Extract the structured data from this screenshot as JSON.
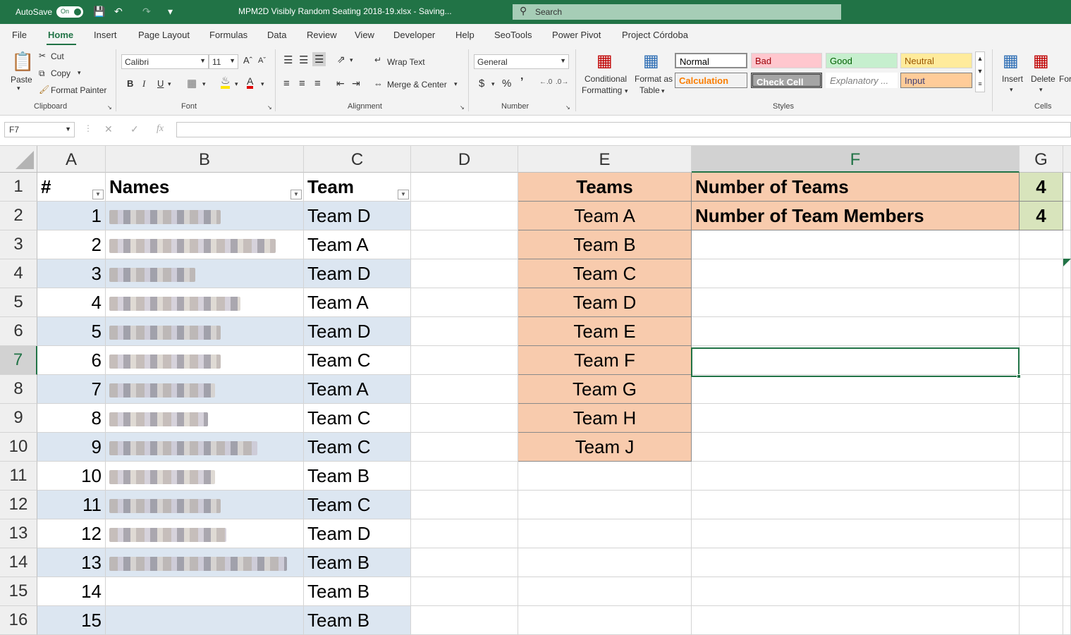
{
  "titlebar": {
    "autosave_label": "AutoSave",
    "toggle_label": "On",
    "document_title": "MPM2D Visibly Random Seating 2018-19.xlsx  -  Saving...",
    "search_placeholder": "Search"
  },
  "ribbon_tabs": [
    "File",
    "Home",
    "Insert",
    "Page Layout",
    "Formulas",
    "Data",
    "Review",
    "View",
    "Developer",
    "Help",
    "SeoTools",
    "Power Pivot",
    "Project Córdoba"
  ],
  "ribbon": {
    "clipboard": {
      "paste": "Paste",
      "cut": "Cut",
      "copy": "Copy",
      "format_painter": "Format Painter",
      "label": "Clipboard"
    },
    "font": {
      "name": "Calibri",
      "size": "11",
      "label": "Font",
      "bold": "B",
      "italic": "I",
      "underline": "U"
    },
    "alignment": {
      "wrap_text": "Wrap Text",
      "merge_center": "Merge & Center",
      "label": "Alignment"
    },
    "number": {
      "format": "General",
      "label": "Number",
      "currency": "$",
      "percent": "%"
    },
    "styles": {
      "conditional_formatting": "Conditional Formatting",
      "conditional_line1": "Conditional",
      "conditional_line2": "Formatting",
      "format_as_table_line1": "Format as",
      "format_as_table_line2": "Table",
      "normal": "Normal",
      "bad": "Bad",
      "good": "Good",
      "neutral": "Neutral",
      "calculation": "Calculation",
      "check_cell": "Check Cell",
      "explanatory": "Explanatory ...",
      "input": "Input",
      "label": "Styles"
    },
    "cells": {
      "insert": "Insert",
      "delete": "Delete",
      "format": "For",
      "label": "Cells"
    }
  },
  "formula_bar": {
    "name_box": "F7",
    "formula": ""
  },
  "columns": [
    "A",
    "B",
    "C",
    "D",
    "E",
    "F",
    "G"
  ],
  "rows": [
    "1",
    "2",
    "3",
    "4",
    "5",
    "6",
    "7",
    "8",
    "9",
    "10",
    "11",
    "12",
    "13",
    "14",
    "15",
    "16"
  ],
  "table": {
    "headers": {
      "num": "#",
      "names": "Names",
      "team": "Team"
    },
    "rows": [
      {
        "num": "1",
        "team": "Team D"
      },
      {
        "num": "2",
        "team": "Team A"
      },
      {
        "num": "3",
        "team": "Team D"
      },
      {
        "num": "4",
        "team": "Team A"
      },
      {
        "num": "5",
        "team": "Team D"
      },
      {
        "num": "6",
        "team": "Team C"
      },
      {
        "num": "7",
        "team": "Team A"
      },
      {
        "num": "8",
        "team": "Team C"
      },
      {
        "num": "9",
        "team": "Team C"
      },
      {
        "num": "10",
        "team": "Team B"
      },
      {
        "num": "11",
        "team": "Team C"
      },
      {
        "num": "12",
        "team": "Team D"
      },
      {
        "num": "13",
        "team": "Team B"
      },
      {
        "num": "14",
        "team": "Team B"
      },
      {
        "num": "15",
        "team": "Team B"
      }
    ]
  },
  "teams_list": {
    "header": "Teams",
    "items": [
      "Team A",
      "Team B",
      "Team C",
      "Team D",
      "Team E",
      "Team F",
      "Team G",
      "Team H",
      "Team J"
    ]
  },
  "settings": {
    "number_of_teams_label": "Number of Teams",
    "number_of_teams_value": "4",
    "team_members_label": "Number of Team Members",
    "team_members_value": "4"
  },
  "colors": {
    "excel_green": "#217346",
    "peach": "#f8cbad",
    "band_blue": "#dce6f1",
    "value_green": "#d8e4bc"
  }
}
